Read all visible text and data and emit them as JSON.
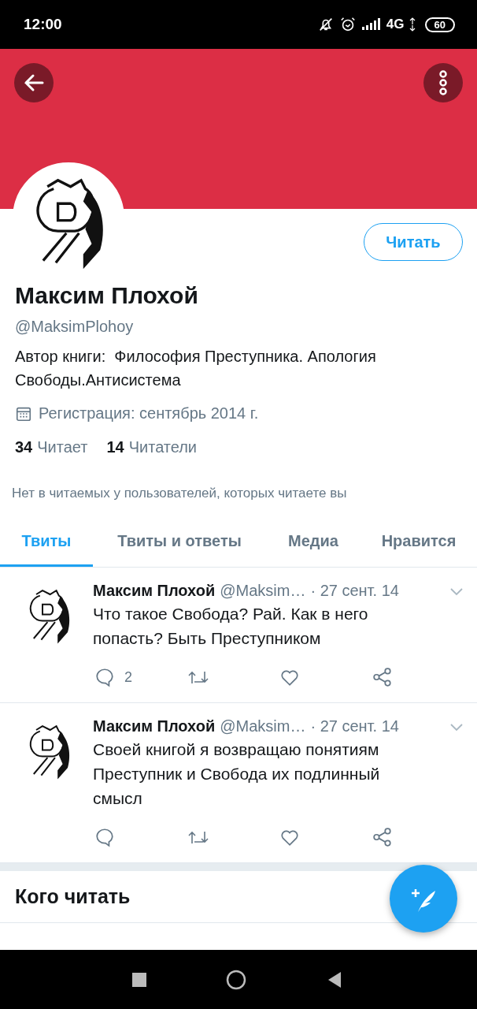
{
  "status_bar": {
    "time": "12:00",
    "network": "4G",
    "battery": "60"
  },
  "profile": {
    "name": "Максим Плохой",
    "handle": "@MaksimPlohoy",
    "follow_button": "Читать",
    "bio": "Автор книги:  Философия Преступника. Апология Свободы.Антисистема",
    "joined": "Регистрация: сентябрь 2014 г.",
    "stats": [
      {
        "count": "34",
        "label": "Читает"
      },
      {
        "count": "14",
        "label": "Читатели"
      }
    ],
    "followers_note": "Нет в читаемых у пользователей, которых читаете вы"
  },
  "tabs": [
    {
      "label": "Твиты",
      "selected": true
    },
    {
      "label": "Твиты и ответы",
      "selected": false
    },
    {
      "label": "Медиа",
      "selected": false
    },
    {
      "label": "Нравится",
      "selected": false
    }
  ],
  "tweets": [
    {
      "name": "Максим Плохой",
      "handle": "@Maksim…",
      "date": "· 27 сент. 14",
      "text": "Что такое Свобода? Рай. Как в него попасть? Быть Преступником",
      "replies": "2"
    },
    {
      "name": "Максим Плохой",
      "handle": "@Maksim…",
      "date": "· 27 сент. 14",
      "text": "Своей книгой я возвращаю понятиям Преступник и Свобода их подлинный смысл"
    }
  ],
  "who_to_follow": {
    "title": "Кого читать"
  }
}
